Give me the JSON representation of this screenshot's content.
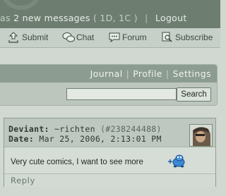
{
  "account": {
    "prefix": "as",
    "messages": "2 new messages",
    "counts": "( 1D, 1C )",
    "logout": "Logout"
  },
  "toolbar": {
    "submit": "Submit",
    "chat": "Chat",
    "forum": "Forum",
    "subscribe": "Subscribe"
  },
  "panel_nav": {
    "journal": "Journal",
    "profile": "Profile",
    "settings": "Settings"
  },
  "search": {
    "value": "",
    "button": "Search"
  },
  "comment": {
    "deviant_label": "Deviant:",
    "author": "~richten",
    "author_id": "(#238244488)",
    "date_label": "Date:",
    "date": "Mar 25, 2006, 2:13:01 PM",
    "body": "Very cute comics, I want to see more",
    "reply": "Reply"
  },
  "colors": {
    "banner": "#6d7e71",
    "toolbar": "#c6cfc8",
    "panel_nav": "#8c9c90",
    "comment_head": "#bfc8c0",
    "emoticon": "#3a88d6"
  }
}
